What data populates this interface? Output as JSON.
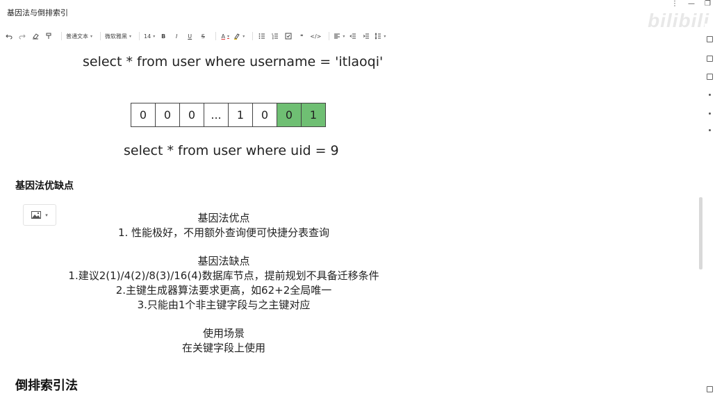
{
  "window": {
    "title": "基因法与倒排索引",
    "controls": [
      "⋮",
      "—",
      "❐"
    ],
    "watermark": "bilibili"
  },
  "toolbar": {
    "undo": "undo-icon",
    "redo": "redo-icon",
    "clear_format": "eraser-icon",
    "format_painter": "paint-brush-icon",
    "paragraph_style": "普通文本",
    "font_family": "微软雅黑",
    "font_size": "14",
    "bold": "B",
    "italic": "I",
    "underline": "U",
    "strike": "S",
    "font_color": "A",
    "highlight": "highlighter-icon",
    "bullet_list": "bullet-list-icon",
    "ordered_list": "ordered-list-icon",
    "task_list": "checkbox-icon",
    "quote": "❝",
    "code": "</>",
    "align": "align-left-icon",
    "outdent": "outdent-icon",
    "indent": "indent-icon",
    "line_height": "line-height-icon"
  },
  "doc": {
    "sql_username": "select * from user where username = 'itlaoqi'",
    "bitmap": {
      "cells": [
        "0",
        "0",
        "0",
        "...",
        "1",
        "0",
        "0",
        "1"
      ],
      "highlight_color": "#6fbf73",
      "highlighted_last": 2
    },
    "sql_uid": "select * from user where uid = 9",
    "heading_pros_cons": "基因法优缺点",
    "image_button": "image-icon",
    "card_lines": [
      "基因法优点",
      "1. 性能极好，不用额外查询便可快捷分表查询",
      "",
      "基因法缺点",
      "1.建议2(1)/4(2)/8(3)/16(4)数据库节点，提前规划不具备迁移条件",
      "2.主键生成器算法要求更高，如62+2全局唯一",
      "3.只能由1个非主键字段与之主键对应",
      "",
      "使用场景",
      "在关键字段上使用"
    ],
    "heading_inverted_index": "倒排索引法"
  }
}
